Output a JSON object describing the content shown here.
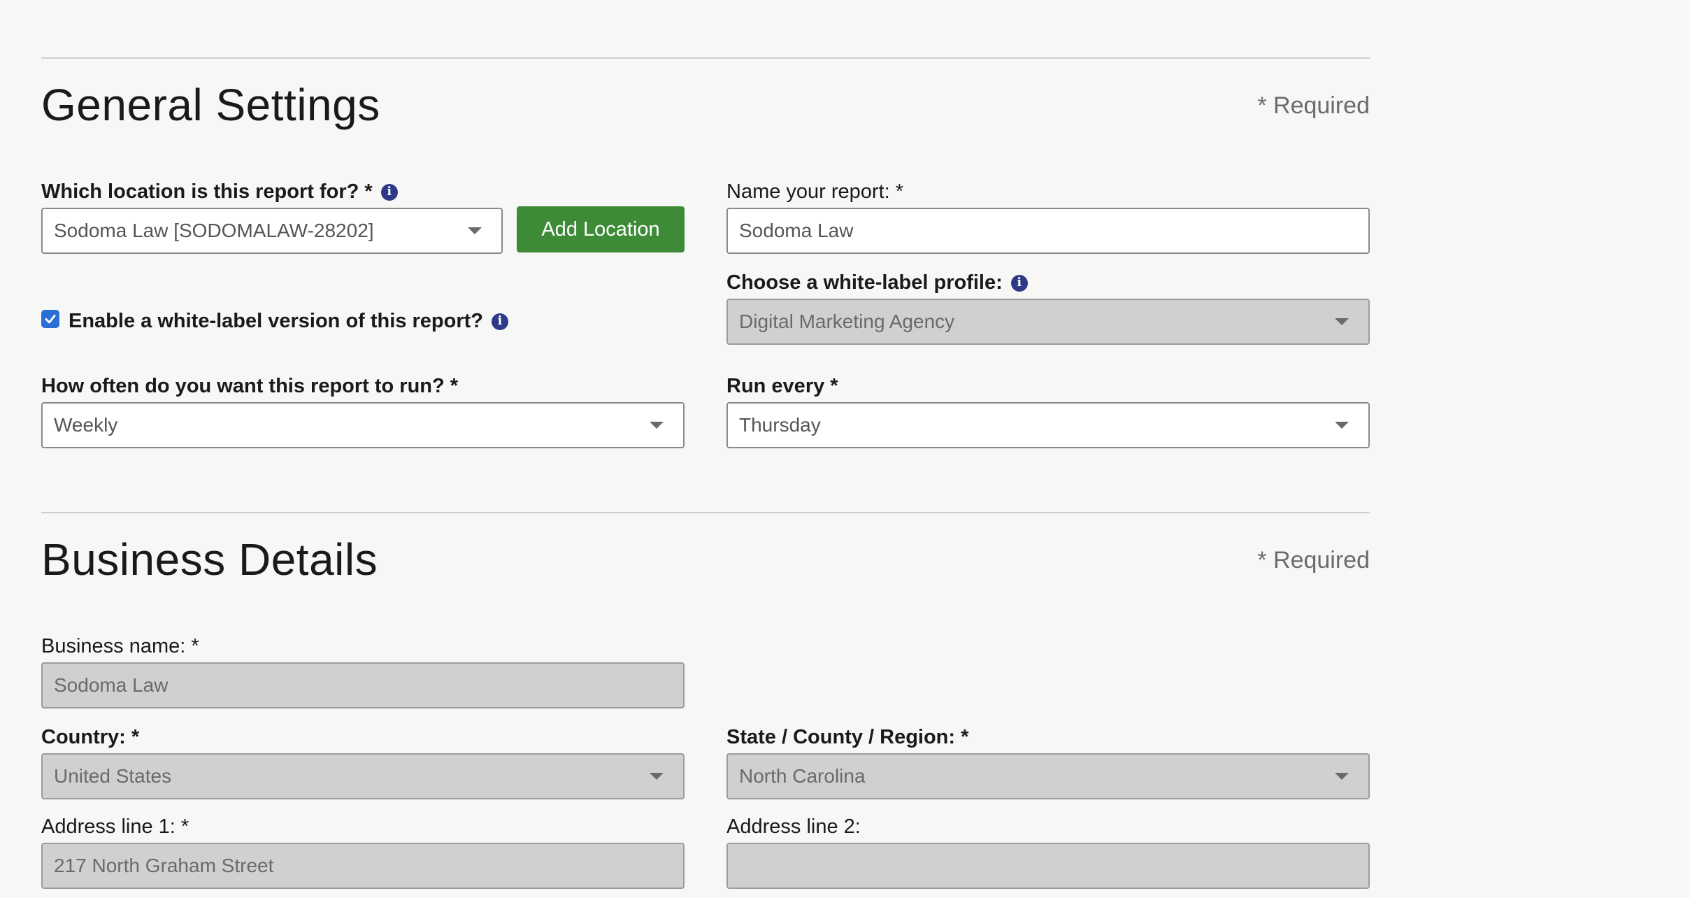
{
  "general": {
    "title": "General Settings",
    "required_note": "* Required",
    "location": {
      "label": "Which location is this report for? *",
      "value": "Sodoma Law [SODOMALAW-28202]",
      "add_button": "Add Location"
    },
    "report_name": {
      "label": "Name your report: *",
      "value": "Sodoma Law"
    },
    "white_label_profile": {
      "label": "Choose a white-label profile:",
      "value": "Digital Marketing Agency"
    },
    "white_label_toggle": {
      "label": "Enable a white-label version of this report?",
      "checked": true
    },
    "frequency": {
      "label": "How often do you want this report to run? *",
      "value": "Weekly"
    },
    "run_every": {
      "label": "Run every *",
      "value": "Thursday"
    }
  },
  "business": {
    "title": "Business Details",
    "required_note": "* Required",
    "business_name": {
      "label": "Business name: *",
      "value": "Sodoma Law"
    },
    "country": {
      "label": "Country: *",
      "value": "United States"
    },
    "state": {
      "label": "State / County / Region: *",
      "value": "North Carolina"
    },
    "address1": {
      "label": "Address line 1: *",
      "value": "217 North Graham Street"
    },
    "address2": {
      "label": "Address line 2:",
      "value": ""
    }
  },
  "icons": {
    "info": "info-icon",
    "dropdown": "chevron-down-icon",
    "checkbox": "check-icon"
  },
  "colors": {
    "accent_green": "#3d8b37",
    "info_blue": "#2e3a87",
    "checkbox_blue": "#2a6fd6",
    "disabled_bg": "#d0d0d0",
    "page_bg": "#f7f7f5"
  }
}
